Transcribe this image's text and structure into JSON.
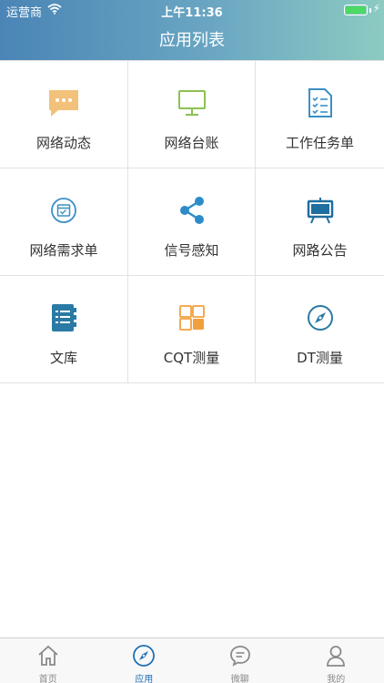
{
  "status_bar": {
    "carrier": "运营商",
    "time": "上午11:36"
  },
  "header": {
    "title": "应用列表"
  },
  "apps": [
    {
      "label": "网络动态",
      "icon": "chat-bubble-icon",
      "color": "#f2c27a"
    },
    {
      "label": "网络台账",
      "icon": "monitor-icon",
      "color": "#8cc152"
    },
    {
      "label": "工作任务单",
      "icon": "checklist-icon",
      "color": "#3b8fc6"
    },
    {
      "label": "网络需求单",
      "icon": "calendar-check-icon",
      "color": "#3b8fc6"
    },
    {
      "label": "信号感知",
      "icon": "share-icon",
      "color": "#2d8bc9"
    },
    {
      "label": "网路公告",
      "icon": "easel-board-icon",
      "color": "#1e6ea0"
    },
    {
      "label": "文库",
      "icon": "notebook-icon",
      "color": "#2a7aa5"
    },
    {
      "label": "CQT测量",
      "icon": "grid-squares-icon",
      "color": "#f2a03d"
    },
    {
      "label": "DT测量",
      "icon": "compass-icon",
      "color": "#2a7aa5"
    }
  ],
  "tabbar": {
    "items": [
      {
        "label": "首页",
        "icon": "home-icon"
      },
      {
        "label": "应用",
        "icon": "compass-icon",
        "active": true
      },
      {
        "label": "微聊",
        "icon": "chat-icon"
      },
      {
        "label": "我的",
        "icon": "user-icon"
      }
    ],
    "active_color": "#1f6fb5",
    "inactive_color": "#8a8a8a"
  }
}
